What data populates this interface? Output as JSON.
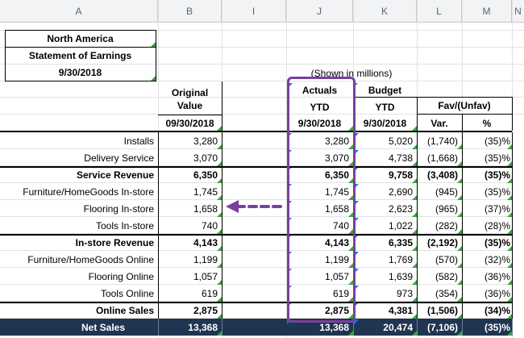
{
  "columns": [
    "A",
    "B",
    "I",
    "J",
    "K",
    "L",
    "M",
    "N"
  ],
  "title_block": {
    "region": "North America",
    "statement": "Statement of Earnings",
    "date": "9/30/2018"
  },
  "shown_note": "(Shown in millions)",
  "headers": {
    "original_line1": "Original",
    "original_line2": "Value",
    "original_date": "09/30/2018",
    "actuals_line1": "Actuals",
    "actuals_line2": "YTD",
    "actuals_date": "9/30/2018",
    "budget_line1": "Budget",
    "budget_line2": "YTD",
    "budget_date": "9/30/2018",
    "fav": "Fav/(Unfav)",
    "var": "Var.",
    "pct": "%"
  },
  "rows": [
    {
      "label": "Installs",
      "original": "3,280",
      "actual": "3,280",
      "budget": "5,020",
      "var": "(1,740)",
      "pct": "(35)%",
      "bold": false
    },
    {
      "label": "Delivery Service",
      "original": "3,070",
      "actual": "3,070",
      "budget": "4,738",
      "var": "(1,668)",
      "pct": "(35)%",
      "bold": false
    },
    {
      "label": "Service Revenue",
      "original": "6,350",
      "actual": "6,350",
      "budget": "9,758",
      "var": "(3,408)",
      "pct": "(35)%",
      "bold": true
    },
    {
      "label": "Furniture/HomeGoods In-store",
      "original": "1,745",
      "actual": "1,745",
      "budget": "2,690",
      "var": "(945)",
      "pct": "(35)%",
      "bold": false
    },
    {
      "label": "Flooring In-store",
      "original": "1,658",
      "actual": "1,658",
      "budget": "2,623",
      "var": "(965)",
      "pct": "(37)%",
      "bold": false
    },
    {
      "label": "Tools In-store",
      "original": "740",
      "actual": "740",
      "budget": "1,022",
      "var": "(282)",
      "pct": "(28)%",
      "bold": false
    },
    {
      "label": "In-store Revenue",
      "original": "4,143",
      "actual": "4,143",
      "budget": "6,335",
      "var": "(2,192)",
      "pct": "(35)%",
      "bold": true
    },
    {
      "label": "Furniture/HomeGoods Online",
      "original": "1,199",
      "actual": "1,199",
      "budget": "1,769",
      "var": "(570)",
      "pct": "(32)%",
      "bold": false
    },
    {
      "label": "Flooring Online",
      "original": "1,057",
      "actual": "1,057",
      "budget": "1,639",
      "var": "(582)",
      "pct": "(36)%",
      "bold": false
    },
    {
      "label": "Tools Online",
      "original": "619",
      "actual": "619",
      "budget": "973",
      "var": "(354)",
      "pct": "(36)%",
      "bold": false
    },
    {
      "label": "Online Sales",
      "original": "2,875",
      "actual": "2,875",
      "budget": "4,381",
      "var": "(1,506)",
      "pct": "(34)%",
      "bold": true
    },
    {
      "label": "Net Sales",
      "original": "13,368",
      "actual": "13,368",
      "budget": "20,474",
      "var": "(7,106)",
      "pct": "(35)%",
      "bold": true,
      "dark": true
    }
  ],
  "colors": {
    "highlight": "#7b3fa0",
    "dark_row": "#1f3550",
    "marker_green": "#3aa63a",
    "marker_blue": "#1a73e8"
  }
}
